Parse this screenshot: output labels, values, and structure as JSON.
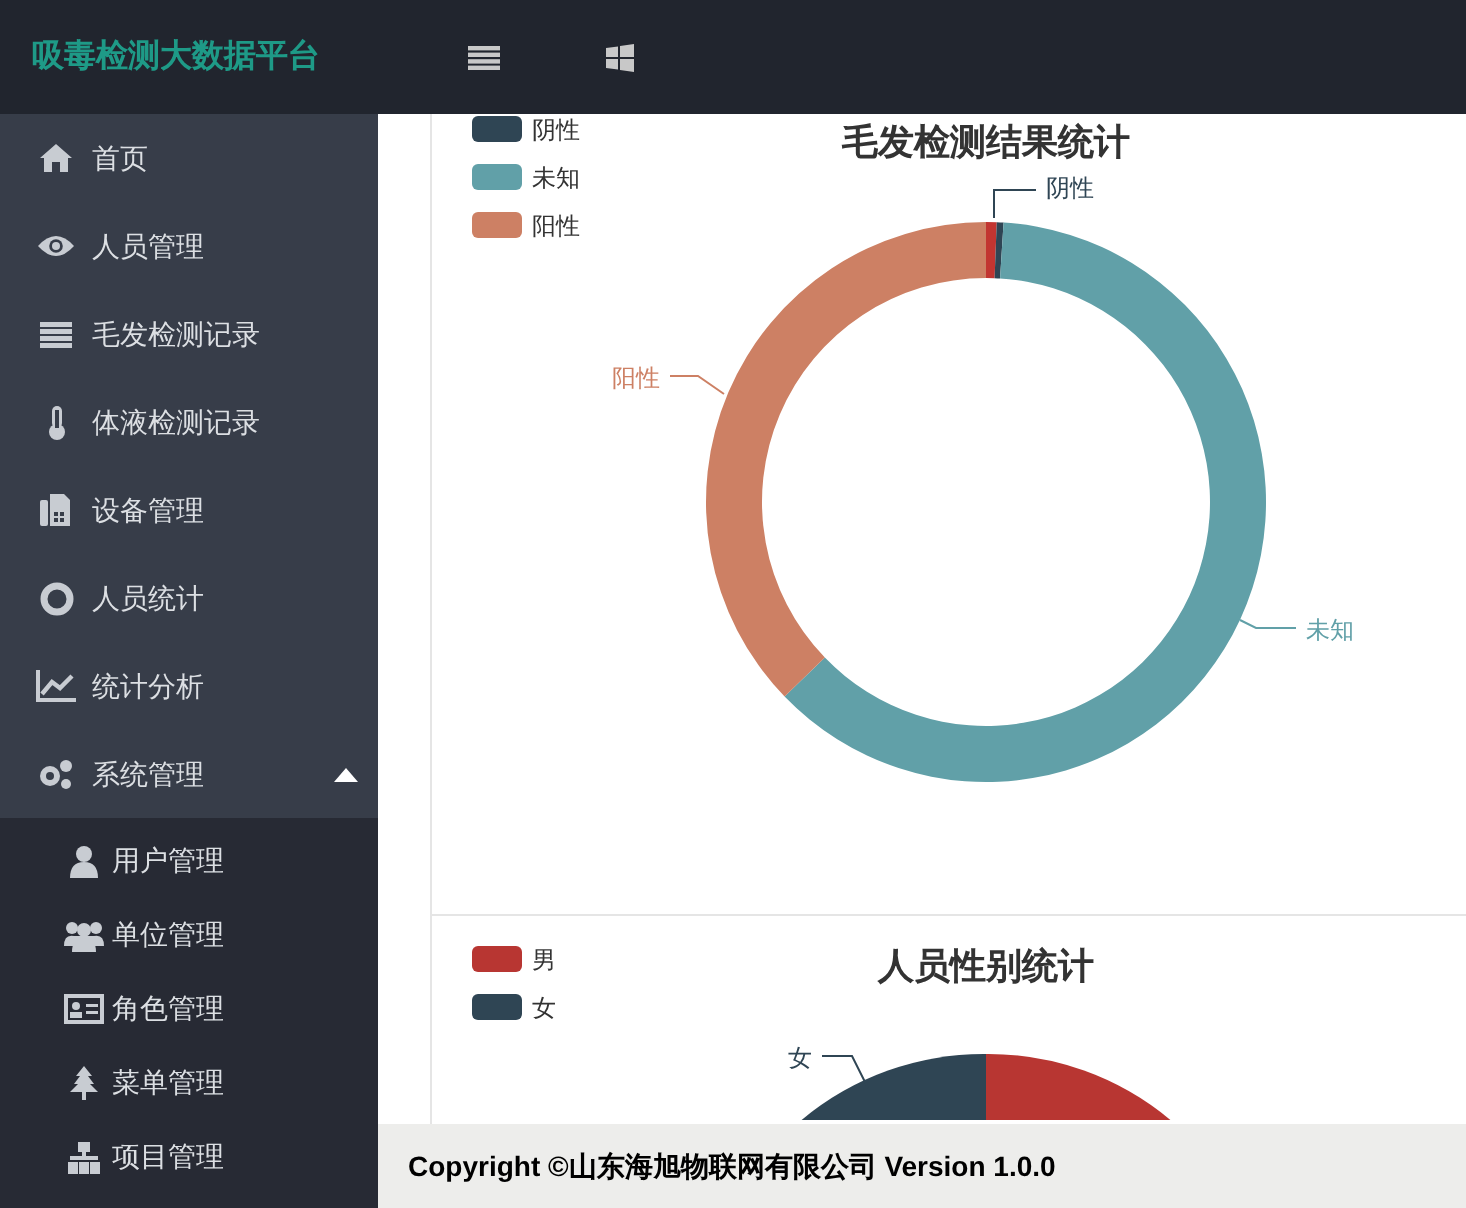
{
  "header": {
    "title": "吸毒检测大数据平台"
  },
  "sidebar": {
    "items": [
      {
        "label": "首页"
      },
      {
        "label": "人员管理"
      },
      {
        "label": "毛发检测记录"
      },
      {
        "label": "体液检测记录"
      },
      {
        "label": "设备管理"
      },
      {
        "label": "人员统计"
      },
      {
        "label": "统计分析"
      },
      {
        "label": "系统管理",
        "expanded": true,
        "children": [
          {
            "label": "用户管理"
          },
          {
            "label": "单位管理"
          },
          {
            "label": "角色管理"
          },
          {
            "label": "菜单管理"
          },
          {
            "label": "项目管理"
          }
        ]
      }
    ]
  },
  "charts": [
    {
      "title": "毛发检测结果统计",
      "legend": [
        {
          "label": "阴性",
          "color": "#2f4554"
        },
        {
          "label": "未知",
          "color": "#61a0a8"
        },
        {
          "label": "阳性",
          "color": "#cd8064"
        }
      ],
      "slice_labels": [
        {
          "label": "阴性",
          "color": "#2f4554"
        },
        {
          "label": "未知",
          "color": "#61a0a8"
        },
        {
          "label": "阳性",
          "color": "#cd8064"
        }
      ]
    },
    {
      "title": "人员性别统计",
      "legend": [
        {
          "label": "男",
          "color": "#b83632"
        },
        {
          "label": "女",
          "color": "#2f4554"
        }
      ],
      "slice_labels": [
        {
          "label": "女",
          "color": "#2f4554"
        }
      ]
    }
  ],
  "footer": {
    "text": "Copyright ©山东海旭物联网有限公司 Version 1.0.0"
  }
}
